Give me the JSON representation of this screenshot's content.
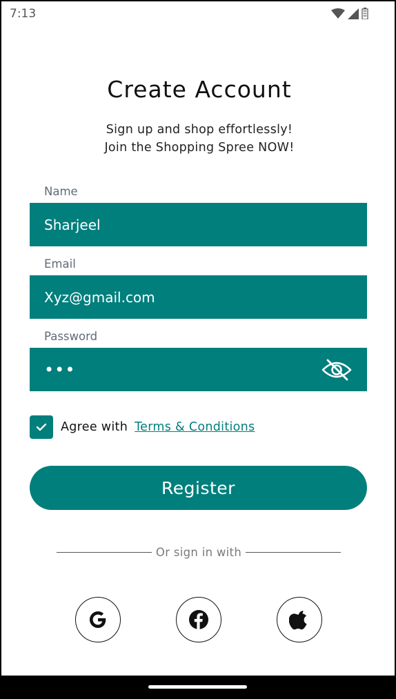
{
  "status_bar": {
    "time": "7:13",
    "icons": [
      "wifi-icon",
      "cell-signal-icon",
      "battery-icon"
    ]
  },
  "header": {
    "title": "Create Account",
    "subtitle_line1": "Sign up and shop effortlessly!",
    "subtitle_line2": "Join the Shopping Spree NOW!"
  },
  "form": {
    "name_label": "Name",
    "name_value": "Sharjeel",
    "email_label": "Email",
    "email_value": "Xyz@gmail.com",
    "password_label": "Password",
    "password_masked": "•••",
    "password_visibility_icon": "eye-off-icon"
  },
  "agreement": {
    "checked": true,
    "text": "Agree with",
    "link_text": "Terms & Conditions"
  },
  "register_button_label": "Register",
  "divider_text": "Or sign in with",
  "social_buttons": [
    "google-icon",
    "facebook-icon",
    "apple-icon"
  ],
  "colors": {
    "primary": "#017f7d",
    "label": "#5f6b77",
    "background": "#ffffff"
  }
}
